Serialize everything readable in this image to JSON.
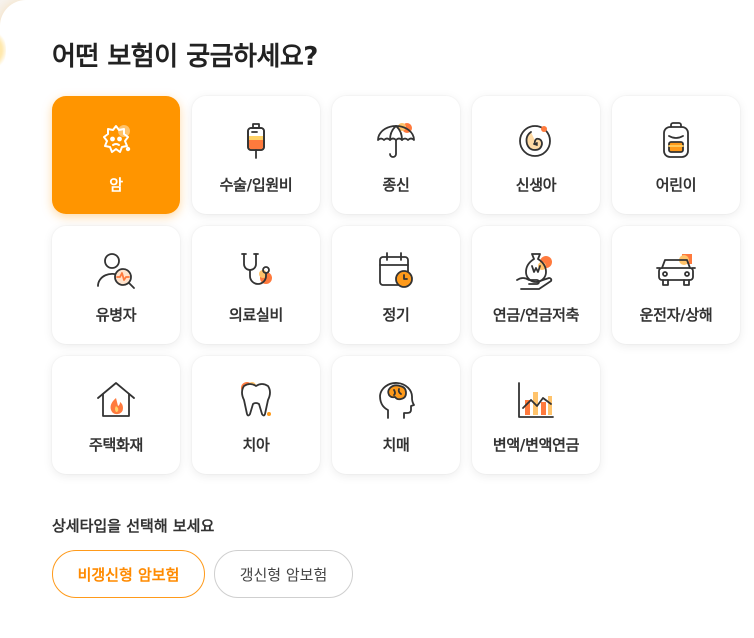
{
  "heading": "어떤 보험이 궁금하세요?",
  "accent_color": "#ff9500",
  "categories": [
    {
      "label": "암",
      "icon": "virus-icon",
      "active": true
    },
    {
      "label": "수술/입원비",
      "icon": "iv-bag-icon"
    },
    {
      "label": "종신",
      "icon": "umbrella-icon"
    },
    {
      "label": "신생아",
      "icon": "baby-icon"
    },
    {
      "label": "어린이",
      "icon": "backpack-icon"
    },
    {
      "label": "유병자",
      "icon": "patient-search-icon"
    },
    {
      "label": "의료실비",
      "icon": "stethoscope-icon"
    },
    {
      "label": "정기",
      "icon": "calendar-clock-icon"
    },
    {
      "label": "연금/연금저축",
      "icon": "money-bag-hand-icon"
    },
    {
      "label": "운전자/상해",
      "icon": "car-icon"
    },
    {
      "label": "주택화재",
      "icon": "house-fire-icon"
    },
    {
      "label": "치아",
      "icon": "tooth-icon"
    },
    {
      "label": "치매",
      "icon": "brain-head-icon"
    },
    {
      "label": "변액/변액연금",
      "icon": "bar-chart-icon"
    }
  ],
  "detail_prompt": "상세타입을 선택해 보세요",
  "detail_types": [
    {
      "label": "비갱신형 암보험",
      "selected": true
    },
    {
      "label": "갱신형 암보험",
      "selected": false
    }
  ]
}
